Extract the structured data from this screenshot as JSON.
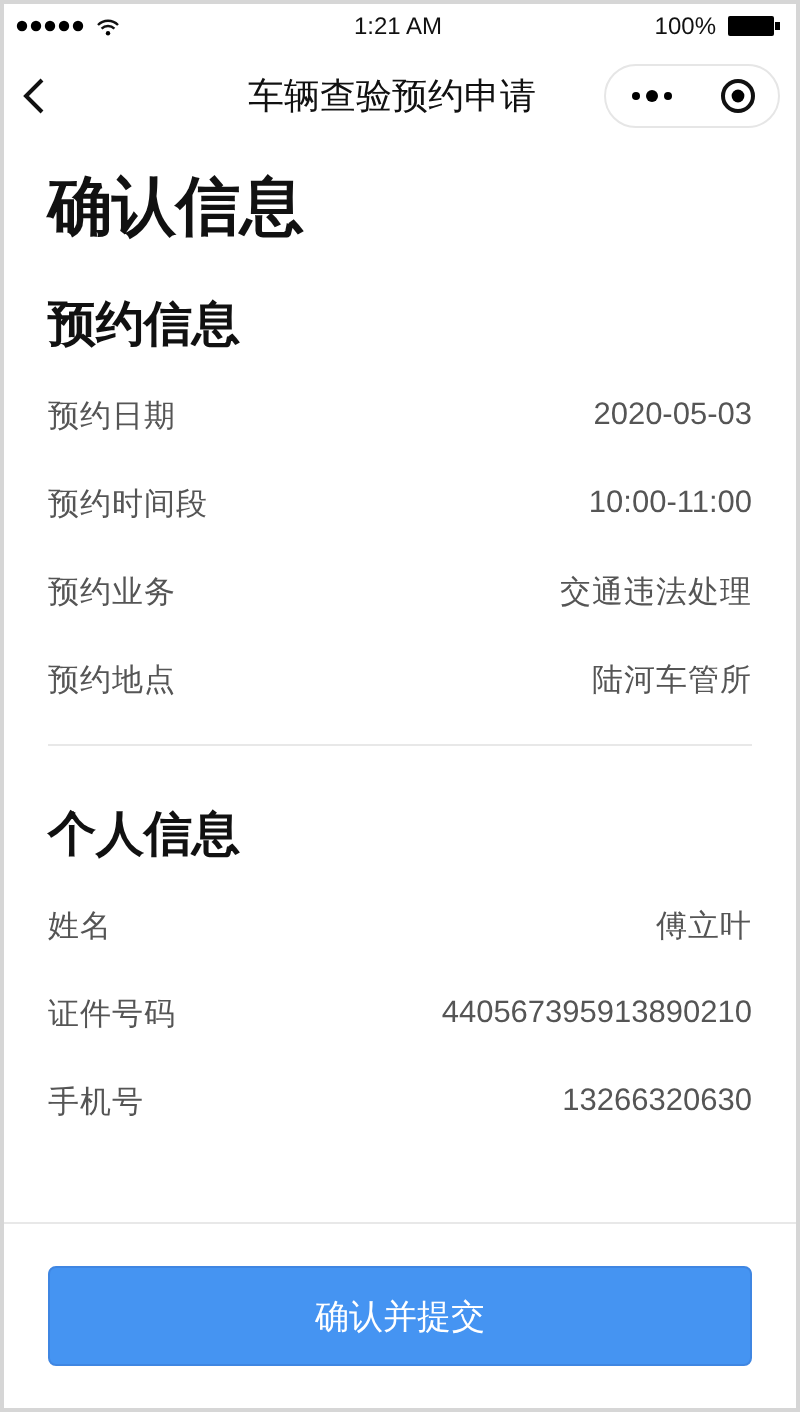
{
  "status_bar": {
    "time": "1:21 AM",
    "battery": "100%"
  },
  "nav_bar": {
    "title": "车辆查验预约申请"
  },
  "page_title": "确认信息",
  "sections": [
    {
      "heading": "预约信息",
      "rows": [
        {
          "label": "预约日期",
          "value": "2020-05-03"
        },
        {
          "label": "预约时间段",
          "value": "10:00-11:00"
        },
        {
          "label": "预约业务",
          "value": "交通违法处理"
        },
        {
          "label": "预约地点",
          "value": "陆河车管所"
        }
      ]
    },
    {
      "heading": "个人信息",
      "rows": [
        {
          "label": "姓名",
          "value": "傅立叶"
        },
        {
          "label": "证件号码",
          "value": "440567395913890210"
        },
        {
          "label": "手机号",
          "value": "13266320630"
        }
      ]
    }
  ],
  "submit_button": "确认并提交"
}
